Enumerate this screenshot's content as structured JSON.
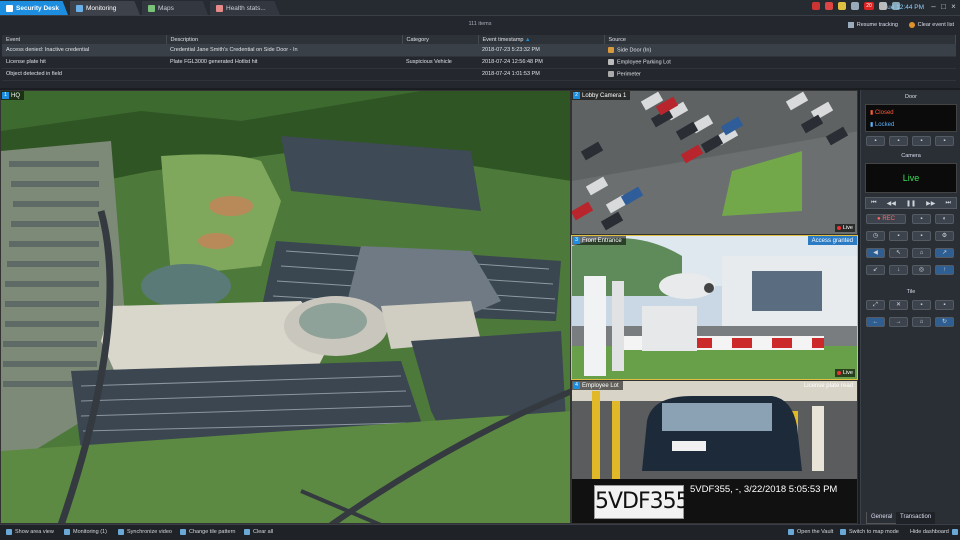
{
  "tabs": [
    {
      "label": "Security Desk"
    },
    {
      "label": "Monitoring"
    },
    {
      "label": "Maps"
    },
    {
      "label": "Health stats..."
    }
  ],
  "tray": {
    "time": "Tue 12:44 PM",
    "alert_count": "20"
  },
  "events": {
    "count": "111 items",
    "resume_label": "Resume tracking",
    "clear_label": "Clear event list",
    "columns": [
      "Event",
      "Description",
      "Category",
      "Event timestamp",
      "Source"
    ],
    "rows": [
      {
        "event": "Access denied: Inactive credential",
        "description": "Credential Jane Smith's Credential on Side Door - In",
        "category": "",
        "timestamp": "2018-07-23 5:23:32 PM",
        "source": "Side Door (In)"
      },
      {
        "event": "License plate hit",
        "description": "Plate FGL3000 generated Hotlist hit",
        "category": "Suspicious Vehicle",
        "timestamp": "2018-07-24 12:56:48 PM",
        "source": "Employee Parking Lot"
      },
      {
        "event": "Object detected in field",
        "description": "",
        "category": "",
        "timestamp": "2018-07-24 1:01:53 PM",
        "source": "Perimeter"
      }
    ]
  },
  "tiles": {
    "map": {
      "num": "1",
      "label": "HQ"
    },
    "lobby": {
      "num": "2",
      "label": "Lobby Camera 1",
      "live": "Live"
    },
    "front": {
      "num": "3",
      "label": "Front Entrance",
      "status": "Access granted",
      "live": "Live"
    },
    "lot": {
      "num": "4",
      "label": "Employee Lot",
      "status": "License plate read",
      "plate": "5VDF355",
      "read_text": "5VDF355, -, 3/22/2018 5:05:53 PM"
    }
  },
  "panel": {
    "door_title": "Door",
    "door_closed": "Closed",
    "door_locked": "Locked",
    "camera_title": "Camera",
    "camera_status": "Live",
    "rec_label": "REC",
    "tile_title": "Tile",
    "tab_general": "General",
    "tab_transaction": "Transaction"
  },
  "bottom": {
    "show_area": "Show area view",
    "monitoring": "Monitoring (1)",
    "sync": "Synchronize video",
    "pattern": "Change tile pattern",
    "clear": "Clear all",
    "vault": "Open the Vault",
    "map_mode": "Switch to map mode",
    "hide": "Hide dashboard"
  },
  "colors": {
    "accent": "#1d8de0",
    "live": "#3ddc5a",
    "closed": "#ff5a3c",
    "locked": "#5ab4ff"
  }
}
